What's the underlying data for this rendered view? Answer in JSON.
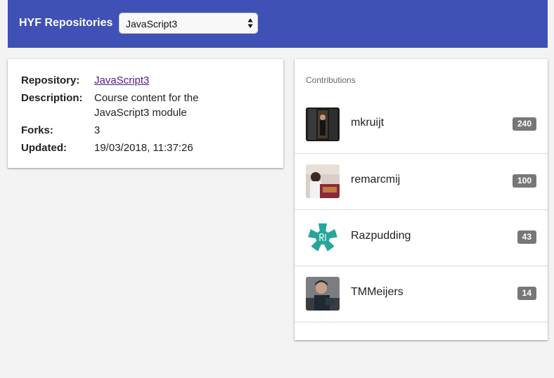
{
  "header": {
    "title": "HYF Repositories",
    "select": {
      "selected": "JavaScript3",
      "arrow_icon": "up-down-arrows-icon"
    },
    "background_color": "#3f51b5"
  },
  "repository": {
    "labels": {
      "repository": "Repository:",
      "description": "Description:",
      "forks": "Forks:",
      "updated": "Updated:"
    },
    "name": "JavaScript3",
    "description": "Course content for the JavaScript3 module",
    "forks": "3",
    "updated": "19/03/2018, 11:37:26",
    "link_color": "#551a8b"
  },
  "contributions": {
    "title": "Contributions",
    "items": [
      {
        "login": "mkruijt",
        "count": "240",
        "avatar": "photo-avatar"
      },
      {
        "login": "remarcmij",
        "count": "100",
        "avatar": "photo-avatar"
      },
      {
        "login": "Razpudding",
        "count": "43",
        "avatar": "teal-logo-avatar"
      },
      {
        "login": "TMMeijers",
        "count": "14",
        "avatar": "photo-avatar"
      }
    ],
    "badge_color": "#777777"
  }
}
